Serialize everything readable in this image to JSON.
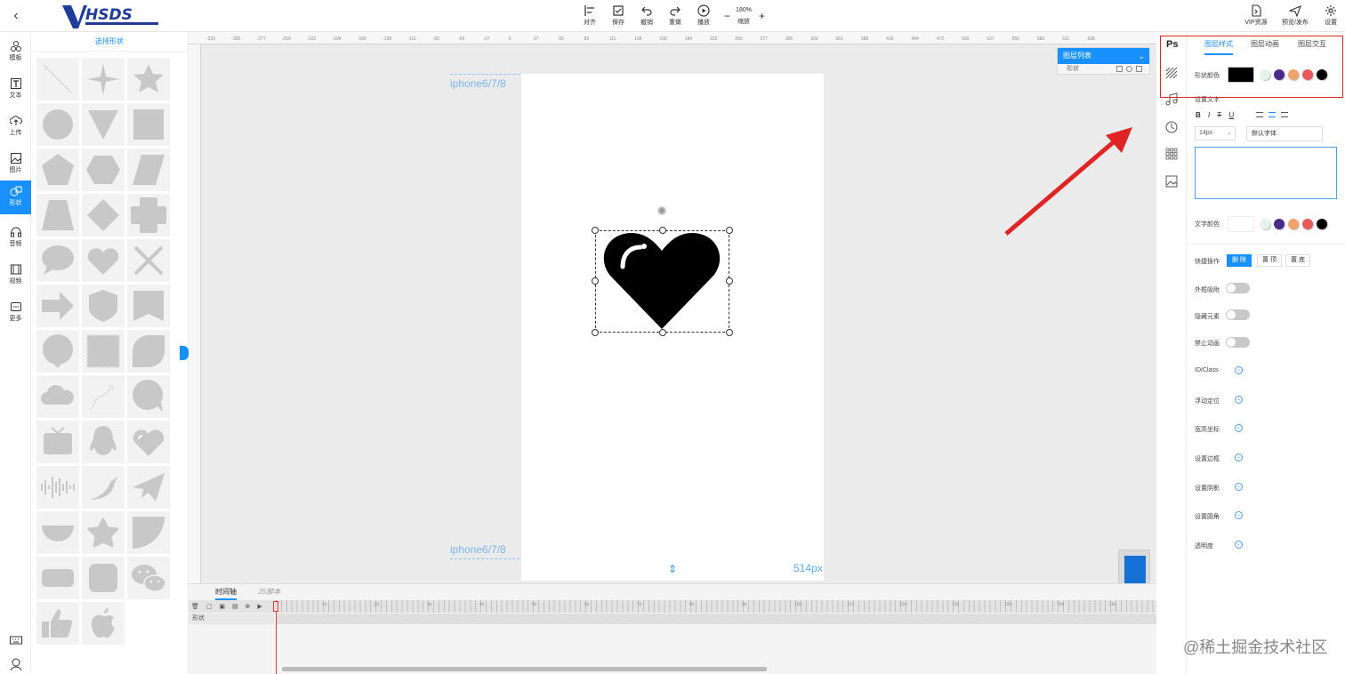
{
  "topbar": {
    "logo_text": "VHSDS",
    "tools": [
      {
        "label": "对齐",
        "icon": "align-icon"
      },
      {
        "label": "保存",
        "icon": "save-icon"
      },
      {
        "label": "撤销",
        "icon": "undo-icon"
      },
      {
        "label": "重做",
        "icon": "redo-icon"
      },
      {
        "label": "播放",
        "icon": "play-icon"
      }
    ],
    "zoom_value": "180%",
    "zoom_label": "缩放",
    "right_tools": [
      {
        "label": "VIP资源",
        "icon": "vip-icon"
      },
      {
        "label": "预览/发布",
        "icon": "send-icon"
      },
      {
        "label": "设置",
        "icon": "gear-icon"
      }
    ]
  },
  "leftnav": {
    "items": [
      {
        "label": "模板",
        "icon": "template-icon"
      },
      {
        "label": "文本",
        "icon": "text-icon"
      },
      {
        "label": "上传",
        "icon": "upload-icon"
      },
      {
        "label": "图片",
        "icon": "image-icon"
      },
      {
        "label": "形状",
        "icon": "shape-icon",
        "active": true
      },
      {
        "label": "音频",
        "icon": "audio-icon"
      },
      {
        "label": "视频",
        "icon": "video-icon"
      },
      {
        "label": "更多",
        "icon": "more-icon"
      }
    ]
  },
  "shape_panel": {
    "title": "选择形状",
    "shapes": [
      "line",
      "sparkle",
      "star",
      "circle",
      "triangle-down",
      "square",
      "pentagon",
      "hexagon",
      "parallelogram",
      "trapezoid",
      "diamond",
      "cross-rounded",
      "speech-bubble",
      "heart",
      "x-mark",
      "arrow-right",
      "shield",
      "banner",
      "bubble-left",
      "stamp",
      "leaf",
      "cloud",
      "curve-arrow",
      "chat-bubble",
      "tv",
      "qq-penguin",
      "heart-shine",
      "sound-wave",
      "bird",
      "paper-plane",
      "half-circle",
      "rounded-star",
      "quarter-circle",
      "rounded-rect",
      "rounded-square",
      "wechat",
      "thumbs-up",
      "apple"
    ]
  },
  "canvas": {
    "device_label_top": "iphone6/7/8",
    "device_label_bottom": "iphone6/7/8",
    "height_label": "514px",
    "ruler_labels": [
      "-333",
      "-305",
      "-277",
      "-250",
      "-222",
      "-194",
      "-166",
      "-138",
      "-111",
      "-83",
      "-55",
      "-27",
      "0",
      "27",
      "55",
      "83",
      "111",
      "138",
      "166",
      "194",
      "222",
      "250",
      "277",
      "305",
      "333",
      "361",
      "388",
      "416",
      "444",
      "472",
      "500",
      "527",
      "555",
      "583",
      "611",
      "638"
    ]
  },
  "layer_panel": {
    "title": "图层列表",
    "items": [
      {
        "label": "形状"
      }
    ]
  },
  "timeline": {
    "tab_timeline": "时间轴",
    "tab_js": "JS脚本",
    "track_label": "形状",
    "seconds": [
      "1s",
      "2s",
      "3s",
      "4s",
      "5s",
      "6s",
      "7s",
      "8s",
      "9s",
      "10s",
      "11s",
      "12s",
      "13s",
      "14s",
      "15s",
      "16s"
    ]
  },
  "right_panel": {
    "ps_label": "Ps",
    "tabs": [
      "图层样式",
      "图层动画",
      "图层交互"
    ],
    "shape_color_label": "形状颜色",
    "shape_color": "#000000",
    "palette": [
      "#e6f3ea",
      "#4b2a8c",
      "#f2a36b",
      "#e85a5a",
      "#000000"
    ],
    "text_settings_label": "设置文字",
    "text_format": [
      "B",
      "I",
      "T",
      "U"
    ],
    "font_size": "14px",
    "font_family": "默认字体",
    "text_color_label": "文字颜色",
    "quick_ops_label": "快捷操作",
    "quick_ops": [
      "删 除",
      "置 顶",
      "置 底"
    ],
    "toggles": [
      "外框吸附",
      "隐藏元素",
      "禁止动画"
    ],
    "expanders": [
      "ID/Class",
      "浮动定位",
      "宽高坐标",
      "设置边框",
      "设置阴影",
      "设置圆角",
      "透明度"
    ]
  },
  "watermark": "@稀土掘金技术社区",
  "colors": {
    "accent": "#1890ff",
    "highlight_box": "#e02424"
  }
}
